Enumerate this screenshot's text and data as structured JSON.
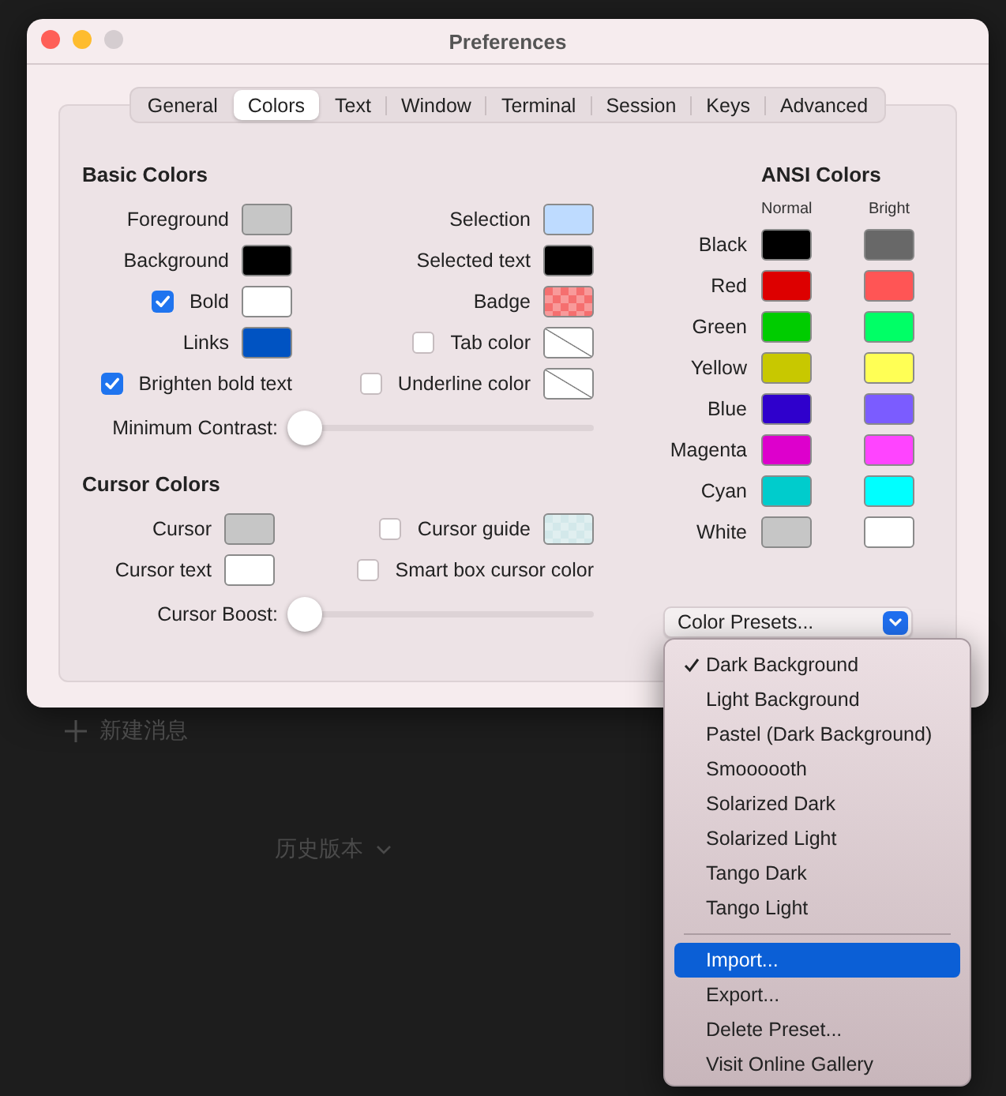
{
  "window": {
    "title": "Preferences"
  },
  "tabs": [
    {
      "label": "General",
      "selected": false
    },
    {
      "label": "Colors",
      "selected": true
    },
    {
      "label": "Text",
      "selected": false
    },
    {
      "label": "Window",
      "selected": false
    },
    {
      "label": "Terminal",
      "selected": false
    },
    {
      "label": "Session",
      "selected": false
    },
    {
      "label": "Keys",
      "selected": false
    },
    {
      "label": "Advanced",
      "selected": false
    }
  ],
  "basic_colors": {
    "heading": "Basic Colors",
    "rows": [
      {
        "left": {
          "label": "Foreground",
          "swatch": {
            "kind": "solid",
            "color": "#c6c6c6"
          }
        },
        "right": {
          "label": "Selection",
          "swatch": {
            "kind": "solid",
            "color": "#bedbff"
          }
        }
      },
      {
        "left": {
          "label": "Background",
          "swatch": {
            "kind": "solid",
            "color": "#000000"
          }
        },
        "right": {
          "label": "Selected text",
          "swatch": {
            "kind": "solid",
            "color": "#000000"
          }
        }
      },
      {
        "left": {
          "label": "Bold",
          "checked": true,
          "swatch": {
            "kind": "solid",
            "color": "#ffffff"
          }
        },
        "right": {
          "label": "Badge",
          "swatch": {
            "kind": "checker",
            "color": "#f56f6f"
          }
        }
      },
      {
        "left": {
          "label": "Links",
          "swatch": {
            "kind": "solid",
            "color": "#0053c2"
          }
        },
        "right": {
          "label": "Tab color",
          "checked": false,
          "swatch": {
            "kind": "none"
          }
        }
      },
      {
        "left": {
          "label": "Brighten bold text",
          "checked": true
        },
        "right": {
          "label": "Underline color",
          "checked": false,
          "swatch": {
            "kind": "none"
          }
        }
      }
    ],
    "slider": {
      "label": "Minimum Contrast:",
      "level": 0
    }
  },
  "cursor_colors": {
    "heading": "Cursor Colors",
    "rows": [
      {
        "left": {
          "label": "Cursor",
          "swatch": {
            "kind": "solid",
            "color": "#c6c6c6"
          }
        },
        "right": {
          "label": "Cursor guide",
          "checked": false,
          "swatch": {
            "kind": "checker",
            "color": "#d3e8ea"
          }
        }
      },
      {
        "left": {
          "label": "Cursor text",
          "swatch": {
            "kind": "solid",
            "color": "#ffffff"
          }
        },
        "right": {
          "label": "Smart box cursor color",
          "checked": false
        }
      }
    ],
    "slider": {
      "label": "Cursor Boost:",
      "level": 0
    }
  },
  "ansi_colors": {
    "heading": "ANSI Colors",
    "columns": [
      "Normal",
      "Bright"
    ],
    "rows": [
      {
        "label": "Black",
        "wells": [
          {
            "color": "#000000"
          },
          {
            "color": "#686868"
          }
        ]
      },
      {
        "label": "Red",
        "wells": [
          {
            "color": "#dd0000"
          },
          {
            "color": "#ff5555"
          }
        ]
      },
      {
        "label": "Green",
        "wells": [
          {
            "color": "#00cc00"
          },
          {
            "color": "#00ff66"
          }
        ]
      },
      {
        "label": "Yellow",
        "wells": [
          {
            "color": "#c8c800"
          },
          {
            "color": "#ffff55"
          }
        ]
      },
      {
        "label": "Blue",
        "wells": [
          {
            "color": "#2f00cc"
          },
          {
            "color": "#7b5cff"
          }
        ]
      },
      {
        "label": "Magenta",
        "wells": [
          {
            "color": "#dd00cc"
          },
          {
            "color": "#ff44ff"
          }
        ]
      },
      {
        "label": "Cyan",
        "wells": [
          {
            "color": "#00cccc"
          },
          {
            "color": "#00ffff"
          }
        ]
      },
      {
        "label": "White",
        "wells": [
          {
            "color": "#c6c6c6"
          },
          {
            "color": "#ffffff"
          }
        ]
      }
    ]
  },
  "presets_button": {
    "label": "Color Presets..."
  },
  "presets_menu": {
    "presets": [
      {
        "label": "Dark Background",
        "selected": true
      },
      {
        "label": "Light Background",
        "selected": false
      },
      {
        "label": "Pastel (Dark Background)",
        "selected": false
      },
      {
        "label": "Smoooooth",
        "selected": false
      },
      {
        "label": "Solarized Dark",
        "selected": false
      },
      {
        "label": "Solarized Light",
        "selected": false
      },
      {
        "label": "Tango Dark",
        "selected": false
      },
      {
        "label": "Tango Light",
        "selected": false
      }
    ],
    "actions": [
      {
        "label": "Import...",
        "highlighted": true
      },
      {
        "label": "Export...",
        "highlighted": false
      },
      {
        "label": "Delete Preset...",
        "highlighted": false
      },
      {
        "label": "Visit Online Gallery",
        "highlighted": false
      }
    ]
  },
  "background": {
    "new_message": "新建消息",
    "history": "历史版本"
  }
}
